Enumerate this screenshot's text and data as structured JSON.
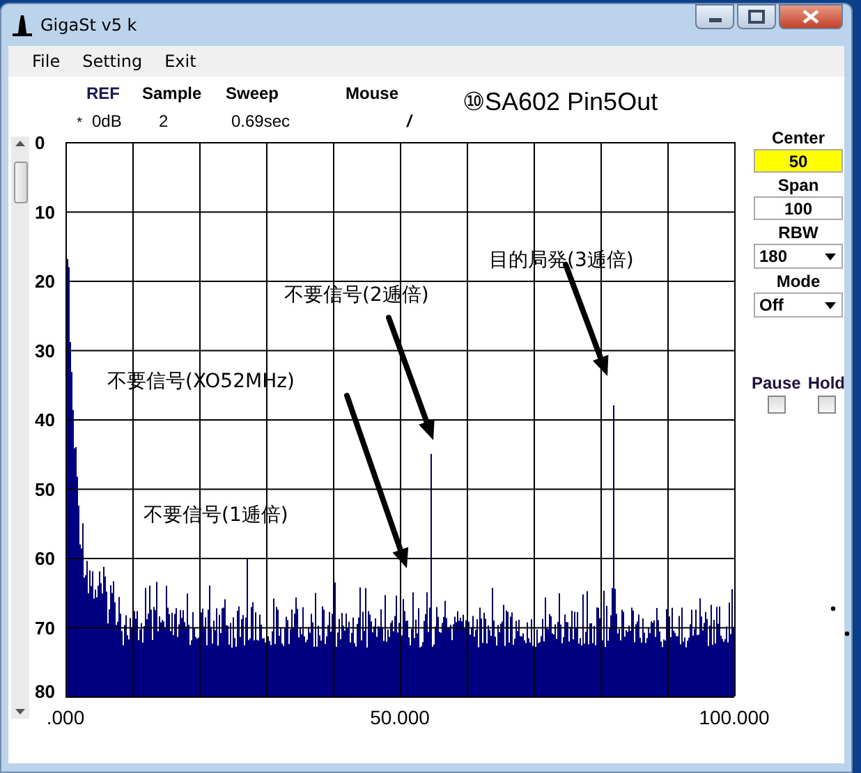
{
  "window": {
    "title": "GigaSt v5 k"
  },
  "menu": [
    "File",
    "Setting",
    "Exit"
  ],
  "readouts": [
    {
      "label": "REF",
      "value": "0dB"
    },
    {
      "label": "Sample",
      "value": "2"
    },
    {
      "label": "Sweep",
      "value": "0.69sec"
    },
    {
      "label": "Mouse",
      "value": "/"
    }
  ],
  "marker": "*",
  "caption": "⑩SA602 Pin5Out",
  "plot": {
    "y_labels": [
      "0",
      "10",
      "20",
      "30",
      "40",
      "50",
      "60",
      "70",
      "80"
    ],
    "x_labels": [
      ".000",
      "50.000",
      "100.000"
    ],
    "annotations": [
      {
        "text": "目的局発(3逓倍)",
        "arrow": true
      },
      {
        "text": "不要信号(2逓倍)",
        "arrow": true
      },
      {
        "text": "不要信号(XO52MHz)",
        "arrow": true
      },
      {
        "text": "不要信号(1逓倍)",
        "arrow": false
      }
    ]
  },
  "controls": [
    {
      "kind": "input",
      "label": "Center",
      "value": "50",
      "focused": true
    },
    {
      "kind": "input",
      "label": "Span",
      "value": "100",
      "focused": false
    },
    {
      "kind": "select",
      "label": "RBW",
      "value": "180"
    },
    {
      "kind": "select",
      "label": "Mode",
      "value": "Off"
    }
  ],
  "toggles": [
    {
      "label": "Pause",
      "checked": false
    },
    {
      "label": "Hold",
      "checked": false
    }
  ]
}
